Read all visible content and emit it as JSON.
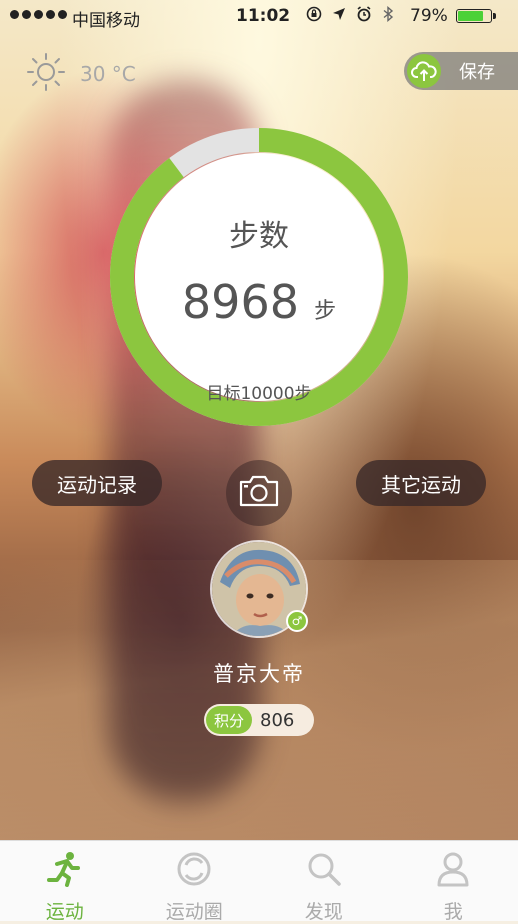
{
  "status_bar": {
    "carrier": "中国移动",
    "time": "11:02",
    "battery_percent": "79%",
    "battery_level": 0.79
  },
  "weather": {
    "icon": "sun-icon",
    "temperature": "30 °C"
  },
  "header": {
    "save_label": "保存",
    "save_icon": "cloud-upload-icon"
  },
  "steps": {
    "title": "步数",
    "value": "8968",
    "unit": "步",
    "target_text": "目标10000步",
    "progress": 0.8968
  },
  "actions": {
    "record_label": "运动记录",
    "other_label": "其它运动",
    "camera_icon": "camera-icon"
  },
  "user": {
    "name": "普京大帝",
    "gender_symbol": "♂",
    "points_label": "积分",
    "points_value": "806"
  },
  "tabs": [
    {
      "label": "运动",
      "icon": "runner-icon",
      "active": true
    },
    {
      "label": "运动圈",
      "icon": "circle-icon",
      "active": false
    },
    {
      "label": "发现",
      "icon": "search-icon",
      "active": false
    },
    {
      "label": "我",
      "icon": "person-icon",
      "active": false
    }
  ],
  "colors": {
    "accent": "#8cc63f",
    "ring_track": "#e3e3e3",
    "tab_active": "#6cb33f",
    "tab_inactive": "#aaaaaa"
  }
}
